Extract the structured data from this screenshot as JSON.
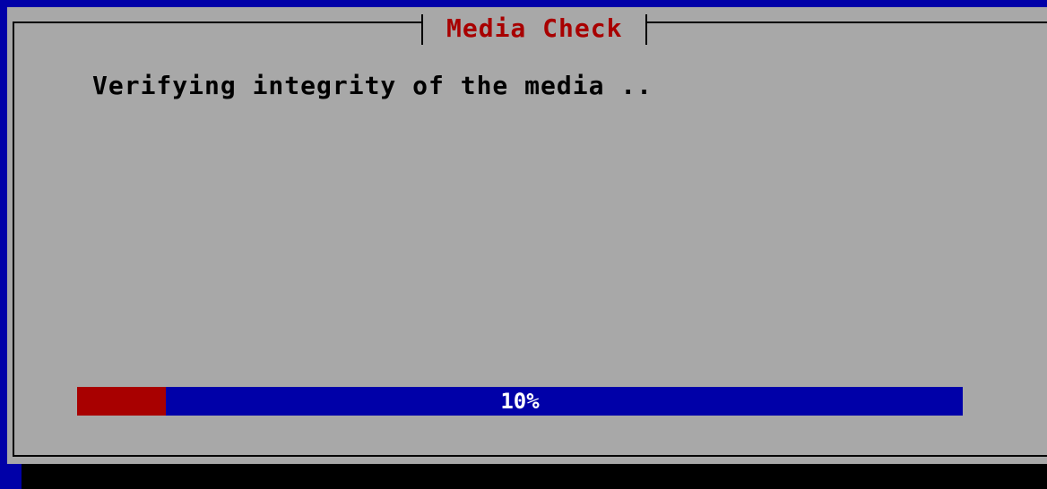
{
  "dialog": {
    "title": "Media Check",
    "message": "Verifying integrity of the media .."
  },
  "progress": {
    "percent": 10,
    "label": "10%"
  },
  "colors": {
    "background": "#0000a8",
    "dialog": "#a8a8a8",
    "title": "#a80000",
    "progress_track": "#0000a8",
    "progress_fill": "#a80000",
    "progress_text": "#ffffff"
  }
}
